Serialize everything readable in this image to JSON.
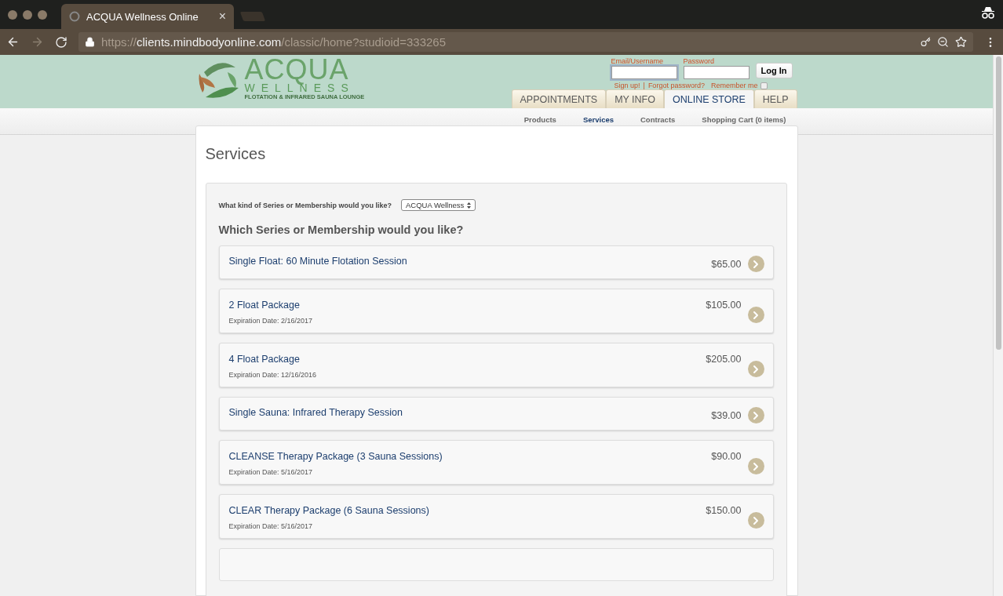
{
  "browser": {
    "tab_title": "ACQUA Wellness Online",
    "tab_close": "×",
    "url": {
      "scheme": "https://",
      "host": "clients.mindbodyonline.com",
      "path": "/classic/home?studioid=333265"
    }
  },
  "header": {
    "logo": {
      "name": "ACQUA",
      "subtitle": "WELLNESS",
      "tagline": "FLOTATION & INFRARED SAUNA LOUNGE"
    },
    "login": {
      "email_label": "Email/Username",
      "password_label": "Password",
      "button": "Log In",
      "sign_up": "Sign up!",
      "separator": "|",
      "forgot": "Forgot password?",
      "remember": "Remember me",
      "remember_checked": false
    },
    "tabs": [
      {
        "label": "APPOINTMENTS",
        "selected": false
      },
      {
        "label": "MY INFO",
        "selected": false
      },
      {
        "label": "ONLINE STORE",
        "selected": true
      },
      {
        "label": "HELP",
        "selected": false
      }
    ],
    "subnav": [
      {
        "label": "Products",
        "selected": false
      },
      {
        "label": "Services",
        "selected": true
      },
      {
        "label": "Contracts",
        "selected": false
      },
      {
        "label": "Shopping Cart (0 items)",
        "selected": false
      }
    ]
  },
  "page": {
    "title": "Services",
    "filter_label": "What kind of Series or Membership would you like?",
    "filter_value": "ACQUA Wellness",
    "question": "Which Series or Membership would you like?",
    "services": [
      {
        "name": "Single Float: 60 Minute Flotation Session",
        "price": "$65.00"
      },
      {
        "name": "2 Float Package",
        "price": "$105.00",
        "expiration": "Expiration Date: 2/16/2017"
      },
      {
        "name": "4 Float Package",
        "price": "$205.00",
        "expiration": "Expiration Date: 12/16/2016"
      },
      {
        "name": "Single Sauna: Infrared Therapy Session",
        "price": "$39.00"
      },
      {
        "name": "CLEANSE Therapy Package (3 Sauna Sessions)",
        "price": "$90.00",
        "expiration": "Expiration Date: 5/16/2017"
      },
      {
        "name": "CLEAR Therapy Package (6 Sauna Sessions)",
        "price": "$150.00",
        "expiration": "Expiration Date: 5/16/2017"
      }
    ]
  }
}
